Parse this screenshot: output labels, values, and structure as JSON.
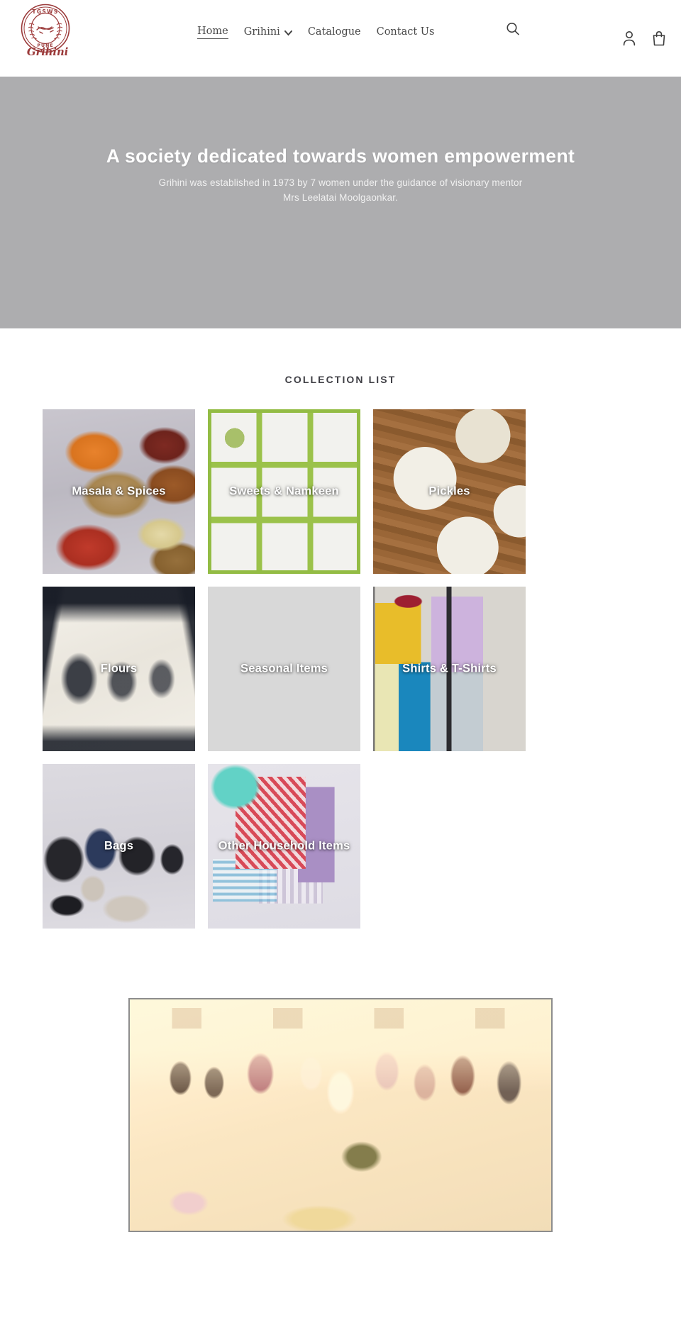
{
  "header": {
    "logo": {
      "seal_top_text": "TGSWS",
      "seal_bottom_text": "PUNE",
      "brand_script": "Grihini",
      "icon": "handshake-seal-logo"
    },
    "nav": [
      {
        "label": "Home",
        "active": true,
        "has_dropdown": false
      },
      {
        "label": "Grihini",
        "active": false,
        "has_dropdown": true
      },
      {
        "label": "Catalogue",
        "active": false,
        "has_dropdown": false
      },
      {
        "label": "Contact Us",
        "active": false,
        "has_dropdown": false
      }
    ],
    "actions": {
      "search_icon": "search-icon",
      "account_icon": "account-person-icon",
      "cart_icon": "shopping-bag-icon"
    }
  },
  "hero": {
    "title": "A society dedicated towards women empowerment",
    "subtitle": "Grihini was established in 1973 by 7 women under the guidance of visionary mentor Mrs Leelatai Moolgaonkar.",
    "background_color": "#adadaf"
  },
  "collections": {
    "heading": "COLLECTION LIST",
    "items": [
      {
        "label": "Masala & Spices",
        "photo": "ph-masala"
      },
      {
        "label": "Sweets & Namkeen",
        "photo": "ph-sweets"
      },
      {
        "label": "Pickles",
        "photo": "ph-pickles"
      },
      {
        "label": "Flours",
        "photo": "ph-flours"
      },
      {
        "label": "Seasonal Items",
        "photo": "ph-seasonal"
      },
      {
        "label": "Shirts & T-Shirts",
        "photo": "ph-shirts"
      },
      {
        "label": "Bags",
        "photo": "ph-bags"
      },
      {
        "label": "Other Household Items",
        "photo": "ph-household"
      }
    ]
  },
  "legacy": {
    "image_alt": "founding-women-group-photo"
  },
  "colors": {
    "brand_maroon": "#9b3a3a",
    "text_dark": "#3f3f45",
    "hero_gray": "#adadaf",
    "sweets_border_green": "#93bc44"
  }
}
